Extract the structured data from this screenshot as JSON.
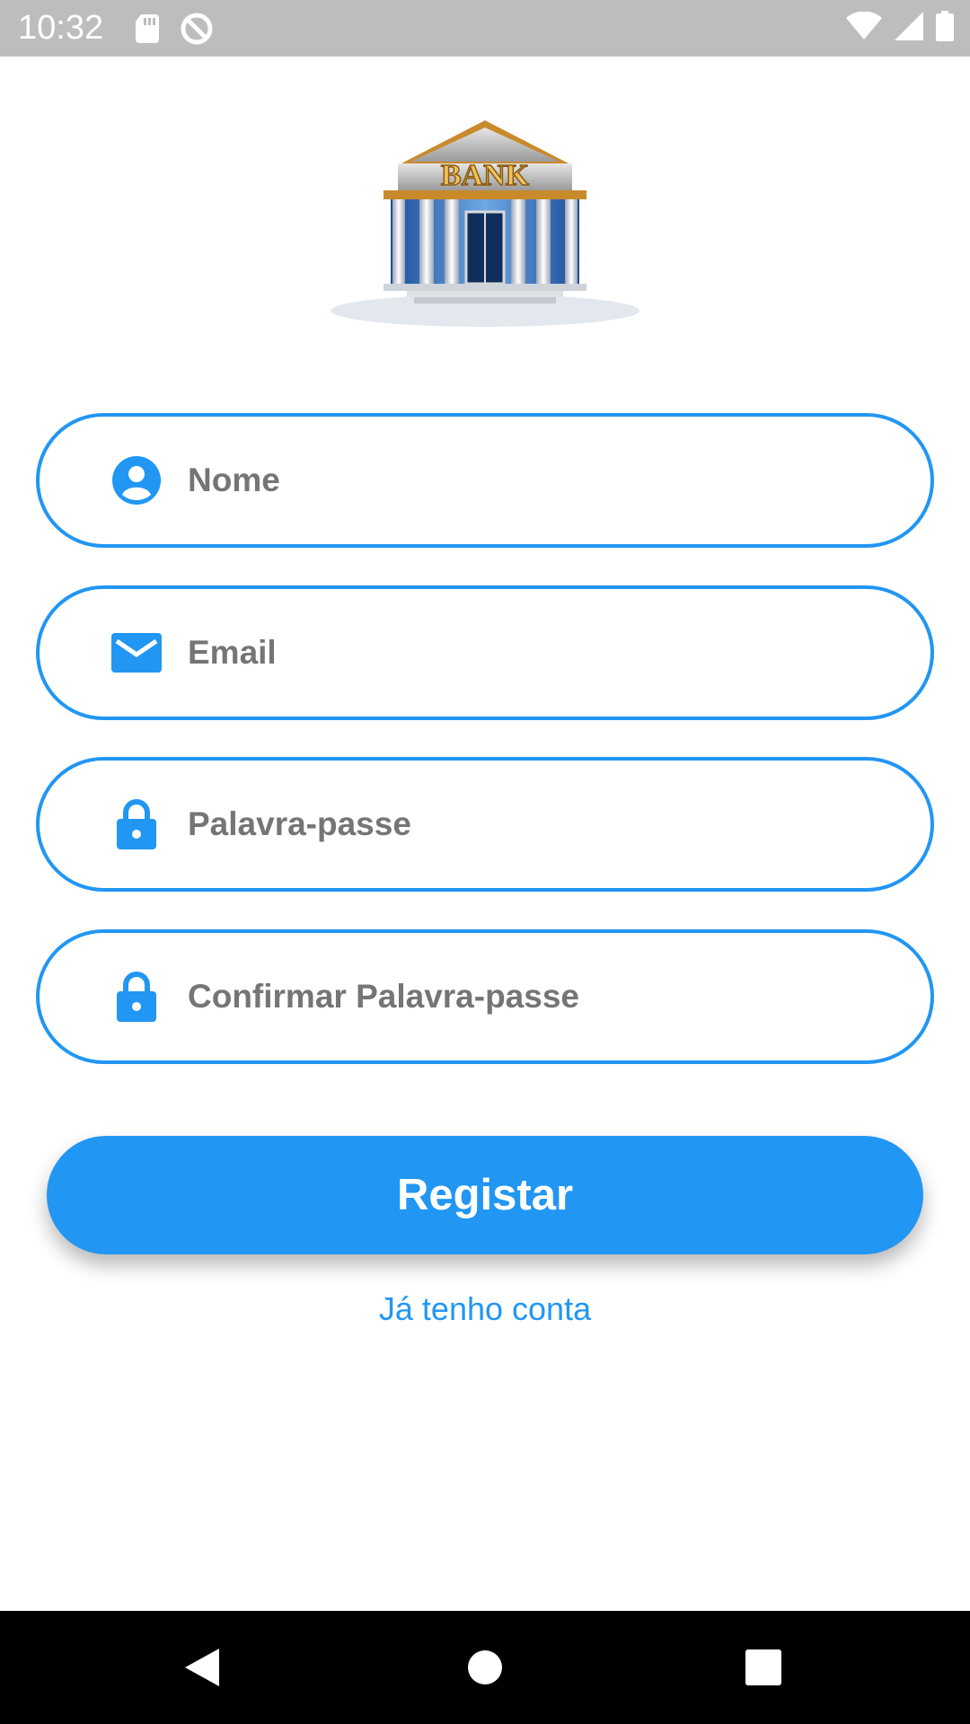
{
  "status_bar": {
    "time": "10:32",
    "icons_left": [
      "sd-card-icon",
      "do-not-disturb-icon"
    ],
    "icons_right": [
      "wifi-icon",
      "cell-signal-icon",
      "battery-icon"
    ]
  },
  "logo": {
    "text": "BANK",
    "icon": "bank-building-logo"
  },
  "form": {
    "fields": [
      {
        "placeholder": "Nome",
        "icon": "account-circle-icon",
        "value": ""
      },
      {
        "placeholder": "Email",
        "icon": "mail-icon",
        "value": ""
      },
      {
        "placeholder": "Palavra-passe",
        "icon": "lock-icon",
        "value": ""
      },
      {
        "placeholder": "Confirmar Palavra-passe",
        "icon": "lock-icon",
        "value": ""
      }
    ],
    "register_label": "Registar",
    "login_link": "Já tenho conta"
  },
  "colors": {
    "accent": "#2196f3",
    "placeholder_text": "#757575",
    "status_bar": "#bdbdbd",
    "nav_bar": "#000000"
  },
  "nav_bar": {
    "buttons": [
      "back-icon",
      "home-icon",
      "recents-icon"
    ]
  }
}
